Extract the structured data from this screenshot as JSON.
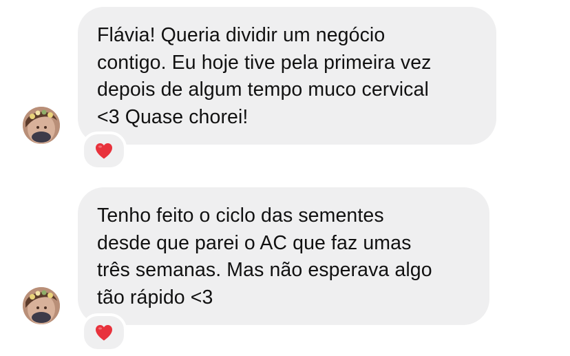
{
  "messages": [
    {
      "text": "Flávia! Queria dividir um negócio\ncontigo. Eu hoje tive pela primeira vez\ndepois de algum tempo muco cervical\n<3 Quase chorei!",
      "reaction": "heart-icon"
    },
    {
      "text": "Tenho feito o ciclo das sementes\ndesde que parei o AC que faz umas\ntrês semanas. Mas não esperava algo\ntão rápido <3",
      "reaction": "heart-icon"
    }
  ],
  "colors": {
    "bubble": "#efeff0",
    "text": "#111111",
    "heart": "#e8323c",
    "background": "#ffffff"
  }
}
